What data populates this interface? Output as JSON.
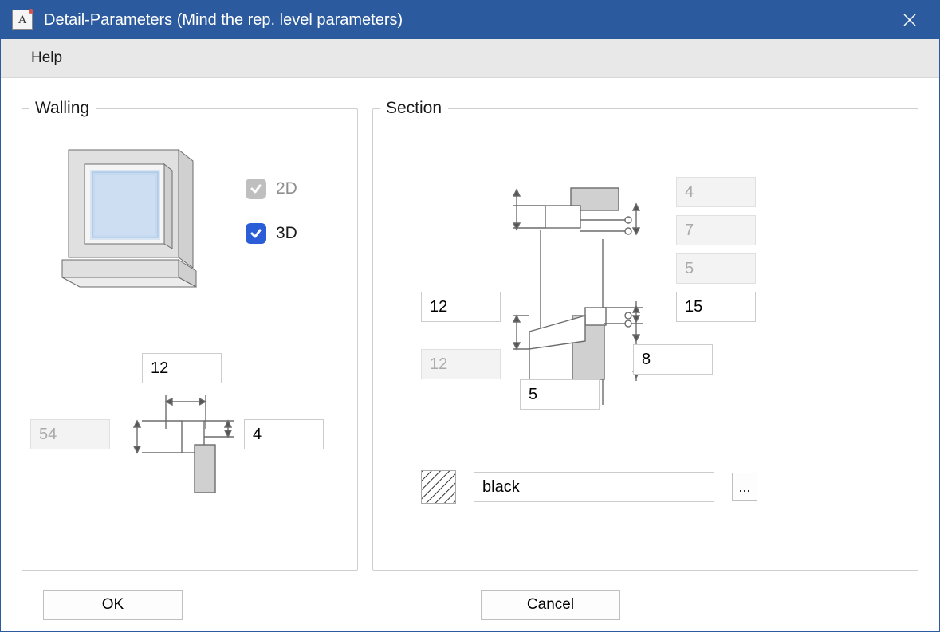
{
  "window": {
    "title": "Detail-Parameters (Mind the rep. level parameters)",
    "app_icon_letter": "A"
  },
  "menubar": {
    "help": "Help"
  },
  "walling": {
    "legend": "Walling",
    "mode2d_label": "2D",
    "mode3d_label": "3D",
    "val_top": "12",
    "val_left": "54",
    "val_right": "4"
  },
  "section": {
    "legend": "Section",
    "v_top1": "4",
    "v_top2": "7",
    "v_top3": "5",
    "v_mid_left": "12",
    "v_mid_right": "15",
    "v_low_left": "12",
    "v_low_mid": "5",
    "v_low_right": "8",
    "color_name": "black",
    "browse_label": "..."
  },
  "buttons": {
    "ok": "OK",
    "cancel": "Cancel"
  }
}
